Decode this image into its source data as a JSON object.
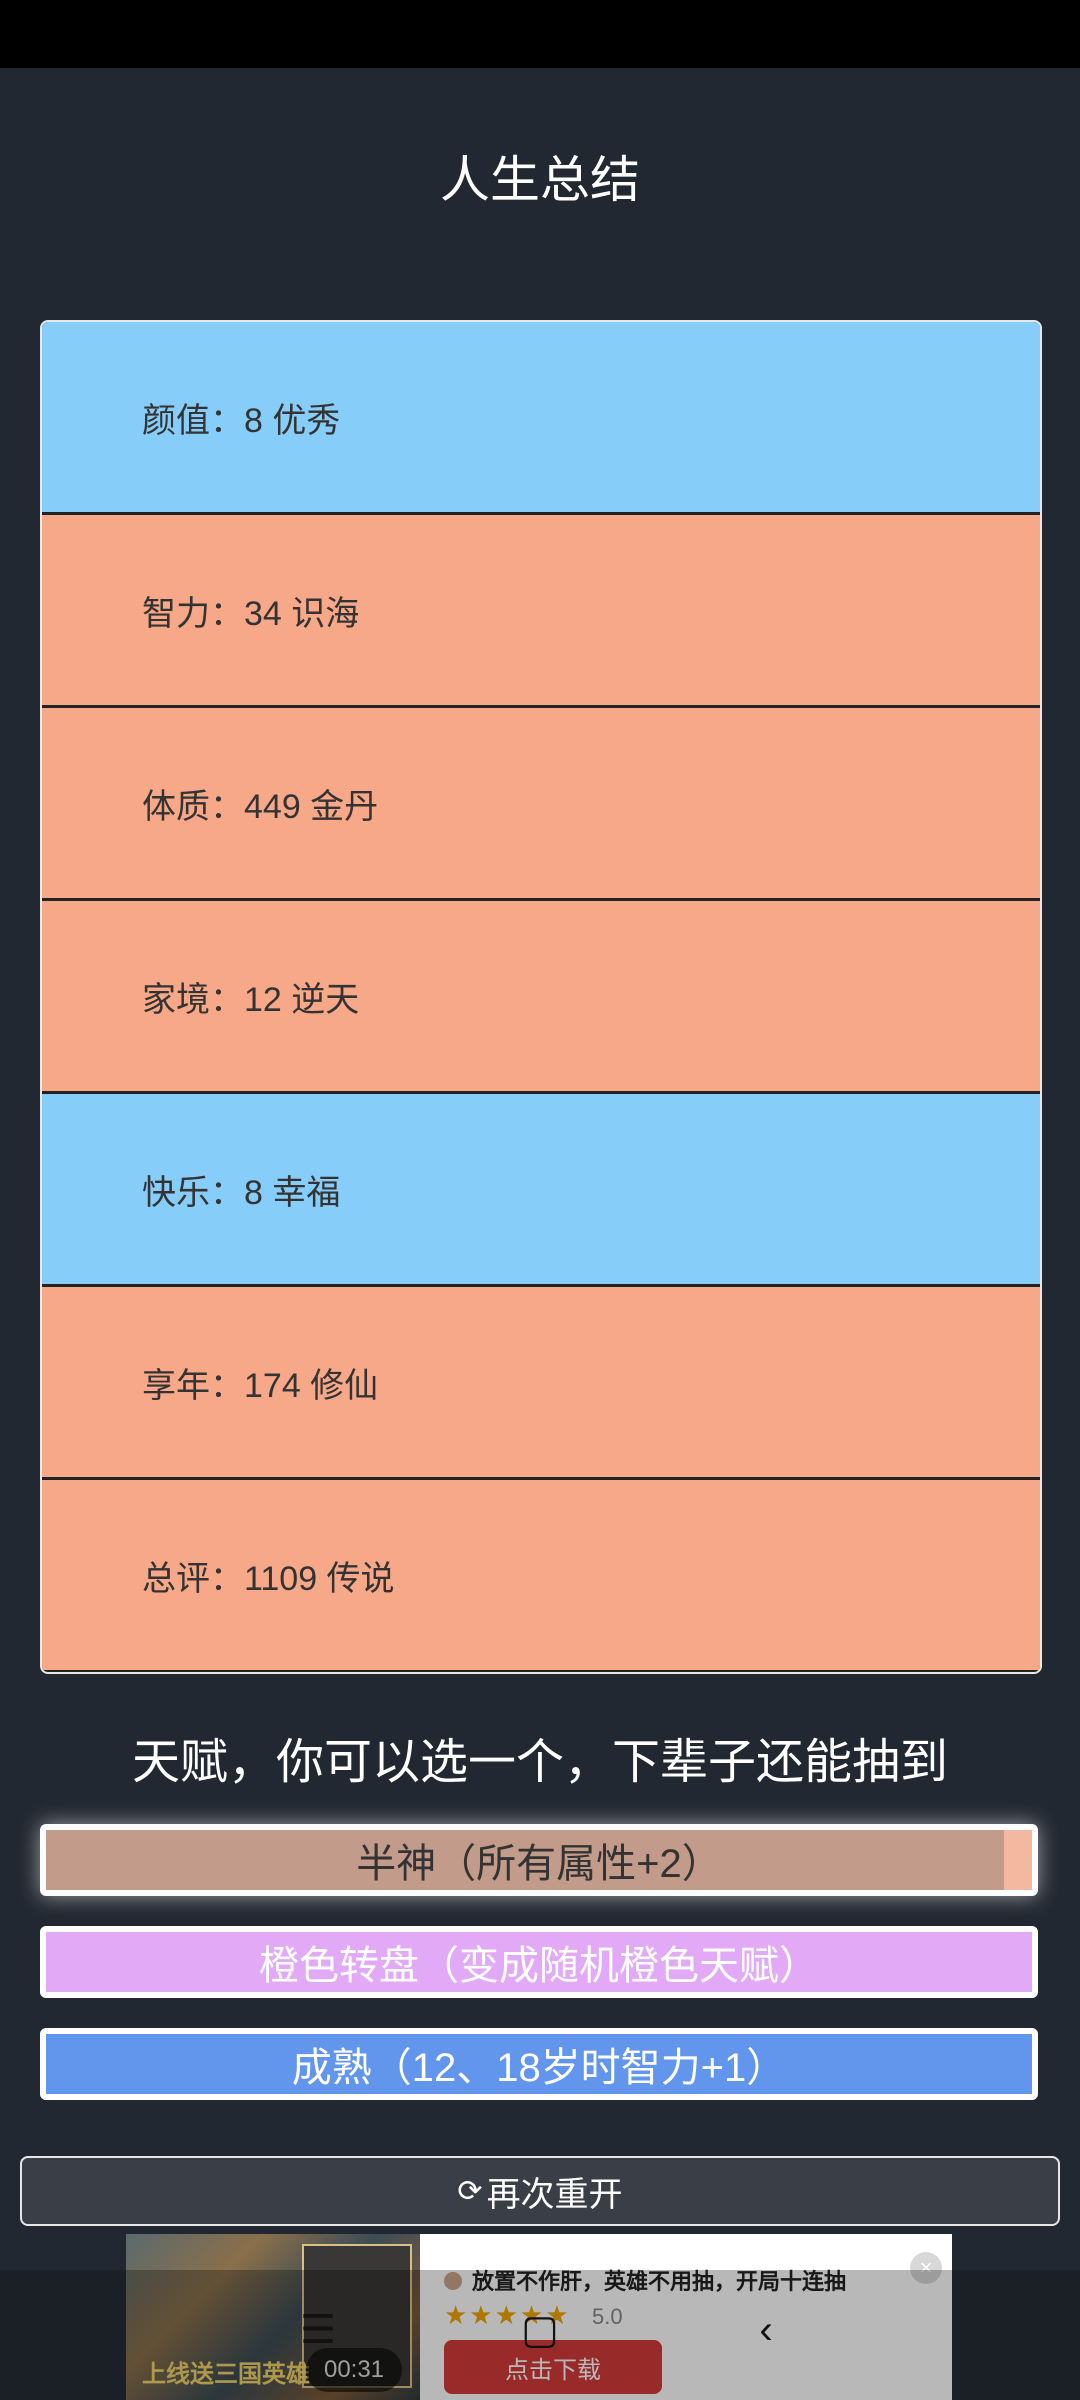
{
  "title": "人生总结",
  "stats": [
    {
      "label": "颜值：8 优秀"
    },
    {
      "label": "智力：34 识海"
    },
    {
      "label": "体质：449 金丹"
    },
    {
      "label": "家境：12 逆天"
    },
    {
      "label": "快乐：8 幸福"
    },
    {
      "label": "享年：174 修仙"
    },
    {
      "label": "总评：1109 传说"
    }
  ],
  "talent_heading": "天赋，你可以选一个，下辈子还能抽到",
  "talents": [
    {
      "label": "半神（所有属性+2）"
    },
    {
      "label": "橙色转盘（变成随机橙色天赋）"
    },
    {
      "label": "成熟（12、18岁时智力+1）"
    }
  ],
  "restart": {
    "icon": "refresh-icon",
    "label": "再次重开"
  },
  "ad": {
    "game_title": "上线送三国英雄",
    "timer": "00:31",
    "text": "放置不作肝，英雄不用抽，开局十连抽",
    "stars": "★★★★★",
    "rating": "5.0",
    "cta": "点击下载"
  },
  "colors": {
    "blue_row": "#87cdf9",
    "orange_row": "#f7a888",
    "background": "#222831"
  }
}
